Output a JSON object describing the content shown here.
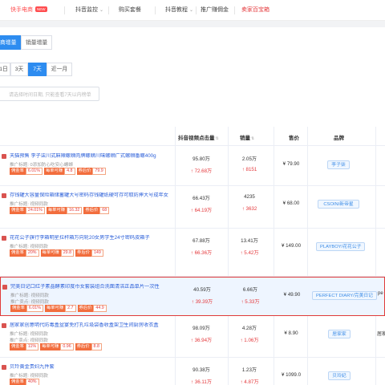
{
  "nav": {
    "items": [
      {
        "label": "快手电商",
        "badge": "NEW",
        "active": true,
        "chevron": false
      },
      {
        "label": "抖音监控",
        "chevron": true
      },
      {
        "label": "购买套餐",
        "chevron": false
      },
      {
        "label": "抖音教程",
        "chevron": true
      },
      {
        "label": "推广赚佣金",
        "chevron": false
      },
      {
        "label": "卖家百宝箱",
        "chevron": false
      }
    ],
    "chevron_glyph": "⌄"
  },
  "tabs": [
    "商增量",
    "销量增量"
  ],
  "periods": [
    "1日",
    "3天",
    "7天",
    "近一月"
  ],
  "search": {
    "placeholder": "请选择时间日期, 只能查看7天以内榜单"
  },
  "table": {
    "headers": {
      "views": "抖音视频点击量",
      "sales": "销量",
      "price": "售价",
      "brand": "品牌"
    },
    "sort_glyph": "⇅",
    "tag_labels": {
      "commission_rate": "佣金率",
      "per_sale": "每单可赚",
      "coupon": "券后价"
    },
    "rows": [
      {
        "title": "天猫预售 李子柒川式麻辣螺蛳肉牌螺蛳川味螺蛳广式螺蛳番螺400g",
        "line1": "推广标题: 0添加防心吃安心螺蛳",
        "line2": "",
        "commission_rate": "6.01%",
        "per_sale": "4.8",
        "coupon": "79.9",
        "views": "95.80万",
        "views_inc": "↑ 72.68万",
        "sales": "2.05万",
        "sales_inc": "↑ 8151",
        "price": "¥ 79.90",
        "brand": "李子柒",
        "extra": ""
      },
      {
        "title": "存钱罐大容量保险箱储蓄罐大号密码存钱罐纸硬可存可取防摔大号成年女",
        "line1": "推广标题: 视频同款",
        "line2": "",
        "commission_rate": "24.01%",
        "per_sale": "16.32",
        "coupon": "68",
        "views": "66.43万",
        "views_inc": "↑ 64.19万",
        "sales": "4235",
        "sales_inc": "↑ 3632",
        "price": "¥ 68.00",
        "brand": "CSOIN/新帝星",
        "extra": ""
      },
      {
        "title": "花花公子旗行李箱明星拉杆箱万向轮20女男学生24寸密码皮箱子",
        "line1": "推广标题: 视频同款",
        "line2": "",
        "commission_rate": "20%",
        "per_sale": "29.8",
        "coupon": "149",
        "views": "67.88万",
        "views_inc": "↑ 66.36万",
        "sales": "13.41万",
        "sales_inc": "↑ 5.42万",
        "price": "¥ 149.00",
        "brand": "PLAYBOY/花花公子",
        "extra": ""
      },
      {
        "title": "完美日记口红子素晶酵素印度巾女套装组合洗面清洁正品单片一次性",
        "line1": "推广标题: 视频同款",
        "line2": "推广卖点: 视频同款",
        "commission_rate": "6.01%",
        "per_sale": "2.7",
        "coupon": "44.9",
        "views": "40.59万",
        "views_inc": "↑ 39.39万",
        "sales": "6.66万",
        "sales_inc": "↑ 5.33万",
        "price": "¥ 49.90",
        "brand": "PERFECT DIARY/完美日记",
        "extra": "pe"
      },
      {
        "title": "居家家创意明代防毒盒盆宴免打孔垃圾袋香收盒架卫生间厨房收衣盒",
        "line1": "推广标题: 视频同款",
        "line2": "推广卖点: 视频同款",
        "commission_rate": "11%",
        "per_sale": "0.96",
        "coupon": "8.8",
        "views": "98.09万",
        "views_inc": "↑ 36.94万",
        "sales": "4.28万",
        "sales_inc": "↑ 1.06万",
        "price": "¥ 8.90",
        "brand": "居家家",
        "extra": "居家家"
      },
      {
        "title": "贝玲黄金贵妇九件套",
        "line1": "推广标题: 视频同款",
        "line2": "",
        "commission_rate": "40%",
        "per_sale": "",
        "coupon": "",
        "views": "90.38万",
        "views_inc": "↑ 36.11万",
        "sales": "1.23万",
        "sales_inc": "↑ 4.87万",
        "price": "¥ 1099.0",
        "brand": "贝玲妃",
        "extra": ""
      }
    ]
  },
  "colors": {
    "accent": "#2d8cf0",
    "red": "#e4393c",
    "orange_tag": "#f26d3d"
  }
}
